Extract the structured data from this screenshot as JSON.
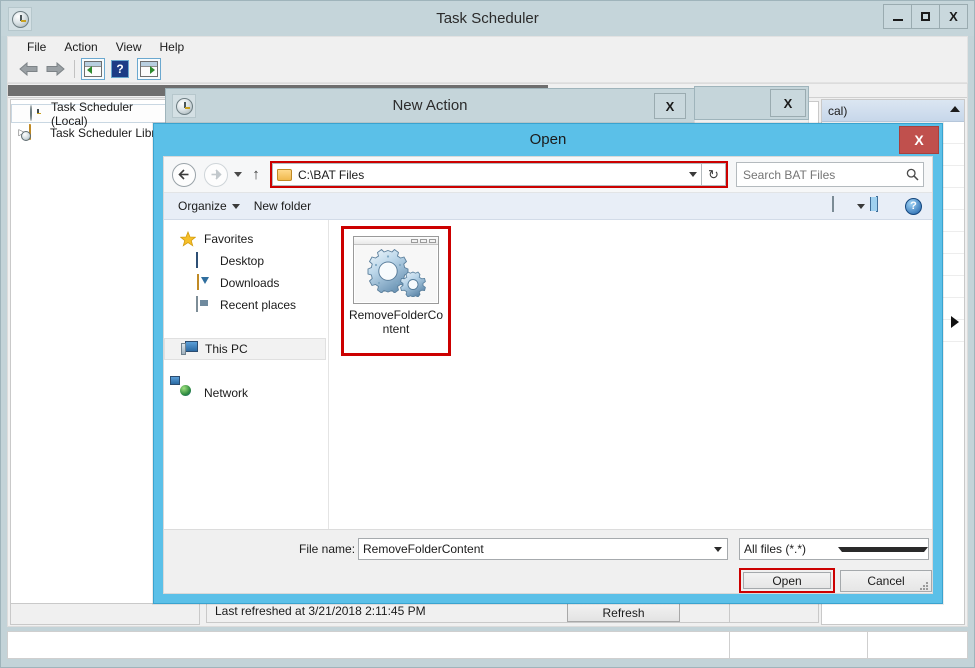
{
  "task_scheduler": {
    "title": "Task Scheduler",
    "sysicon": "clock-icon",
    "window_controls": {
      "minimize": "minimize-icon",
      "maximize": "maximize-icon",
      "close": "X"
    },
    "menu": [
      "File",
      "Action",
      "View",
      "Help"
    ],
    "toolbar": {
      "back": "back-arrow-icon",
      "forward": "forward-arrow-icon",
      "show_hide_tree": "show-tree-icon",
      "help": "?",
      "show_hide_action_pane": "show-action-pane-icon"
    },
    "tree": [
      {
        "label": "Task Scheduler (Local)",
        "icon": "clock-icon",
        "expander": "",
        "selected": true
      },
      {
        "label": "Task Scheduler Librar",
        "icon": "folder-clock-icon",
        "expander": "▷",
        "selected": false
      }
    ],
    "center_status": {
      "last_refreshed": "Last refreshed at 3/21/2018 2:11:45 PM",
      "refresh_label": "Refresh"
    },
    "action_pane": {
      "header": "cal)",
      "collapse": "collapse-icon",
      "play": "play-icon"
    }
  },
  "new_action": {
    "title": "New Action",
    "sysicon": "clock-icon",
    "close": "X"
  },
  "stray_window": {
    "close": "X"
  },
  "open_dialog": {
    "title": "Open",
    "close": "X",
    "nav": {
      "back": "back-icon",
      "forward": "forward-icon",
      "recent_dropdown": "chevron-down-icon",
      "up": "up-arrow-icon"
    },
    "address": {
      "icon": "folder-icon",
      "value": "C:\\BAT Files",
      "dropdown": "chevron-down-icon",
      "refresh": "↻"
    },
    "search": {
      "placeholder": "Search BAT Files",
      "icon": "search-icon"
    },
    "command_bar": {
      "organize": "Organize",
      "organize_caret": "chevron-down-icon",
      "new_folder": "New folder",
      "preview_pane": "preview-pane-icon",
      "preview_caret": "chevron-down-icon",
      "layout_pane": "layout-pane-icon",
      "help": "help-icon"
    },
    "nav_pane": [
      {
        "label": "Favorites",
        "icon": "star-icon",
        "level": 0,
        "selected": false
      },
      {
        "label": "Desktop",
        "icon": "desktop-icon",
        "level": 1,
        "selected": false
      },
      {
        "label": "Downloads",
        "icon": "downloads-icon",
        "level": 1,
        "selected": false
      },
      {
        "label": "Recent places",
        "icon": "recent-places-icon",
        "level": 1,
        "selected": false
      },
      {
        "label": "This PC",
        "icon": "this-pc-icon",
        "level": 0,
        "selected": true
      },
      {
        "label": "Network",
        "icon": "network-icon",
        "level": 0,
        "selected": false
      }
    ],
    "files": [
      {
        "name": "RemoveFolderContent",
        "icon": "bat-script-gears-icon",
        "selected": true,
        "highlighted": true
      }
    ],
    "footer": {
      "file_name_label": "File name:",
      "file_name_value": "RemoveFolderContent",
      "file_name_dropdown": "chevron-down-icon",
      "file_type_value": "All files (*.*)",
      "file_type_dropdown": "chevron-down-icon",
      "open_button": "Open",
      "cancel_button": "Cancel",
      "resize_grip": "resize-grip-icon"
    }
  },
  "highlights": {
    "color": "#cc0000",
    "accent": "#5bc0e8",
    "close_red": "#c0504d"
  }
}
